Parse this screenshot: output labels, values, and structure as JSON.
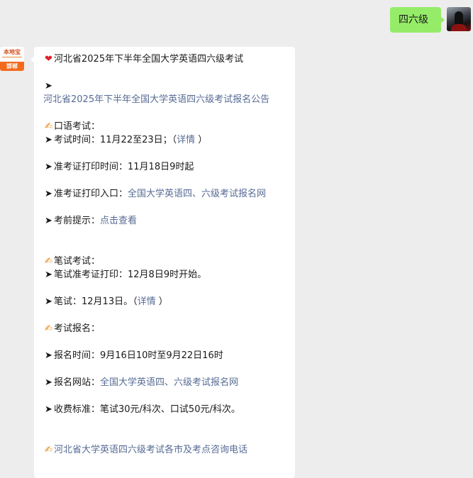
{
  "user_message": {
    "text": "四六级"
  },
  "bot_avatar": {
    "brand": "本地宝",
    "city": "邯郸"
  },
  "bot_message": {
    "lines": [
      [
        {
          "icon": "heart",
          "text": "河北省2025年下半年全国大学英语四六级考试"
        }
      ],
      [],
      [
        {
          "icon": "arrow",
          "text": ""
        }
      ],
      [
        {
          "text": "河北省2025年下半年全国大学英语四六级考试报名公告",
          "link": true
        }
      ],
      [],
      [
        {
          "icon": "pen",
          "text": "口语考试："
        }
      ],
      [
        {
          "icon": "arrow",
          "text": "考试时间：11月22至23日；（"
        },
        {
          "text": "详情",
          "link": true
        },
        {
          "text": " ）"
        }
      ],
      [],
      [
        {
          "icon": "arrow",
          "text": "准考证打印时间：11月18日9时起"
        }
      ],
      [],
      [
        {
          "icon": "arrow",
          "text": "准考证打印入口："
        },
        {
          "text": "全国大学英语四、六级考试报名网",
          "link": true
        }
      ],
      [],
      [
        {
          "icon": "arrow",
          "text": "考前提示："
        },
        {
          "text": "点击查看",
          "link": true
        }
      ],
      [],
      [],
      [
        {
          "icon": "pen",
          "text": "笔试考试："
        }
      ],
      [
        {
          "icon": "arrow",
          "text": "笔试准考证打印：12月8日9时开始。"
        }
      ],
      [],
      [
        {
          "icon": "arrow",
          "text": "笔试：12月13日。（"
        },
        {
          "text": "详情",
          "link": true
        },
        {
          "text": " ）"
        }
      ],
      [],
      [
        {
          "icon": "pen",
          "text": "考试报名："
        }
      ],
      [],
      [
        {
          "icon": "arrow",
          "text": "报名时间：9月16日10时至9月22日16时"
        }
      ],
      [],
      [
        {
          "icon": "arrow",
          "text": "报名网站："
        },
        {
          "text": "全国大学英语四、六级考试报名网",
          "link": true
        }
      ],
      [],
      [
        {
          "icon": "arrow",
          "text": "收费标准：笔试30元/科次、口试50元/科次。"
        }
      ],
      [],
      [],
      [
        {
          "icon": "pen",
          "text": ""
        },
        {
          "text": "河北省大学英语四六级考试各市及考点咨询电话",
          "link": true
        }
      ]
    ]
  },
  "colors": {
    "bubble_me": "#95ec69",
    "link": "#576b95",
    "background": "#ededed"
  }
}
